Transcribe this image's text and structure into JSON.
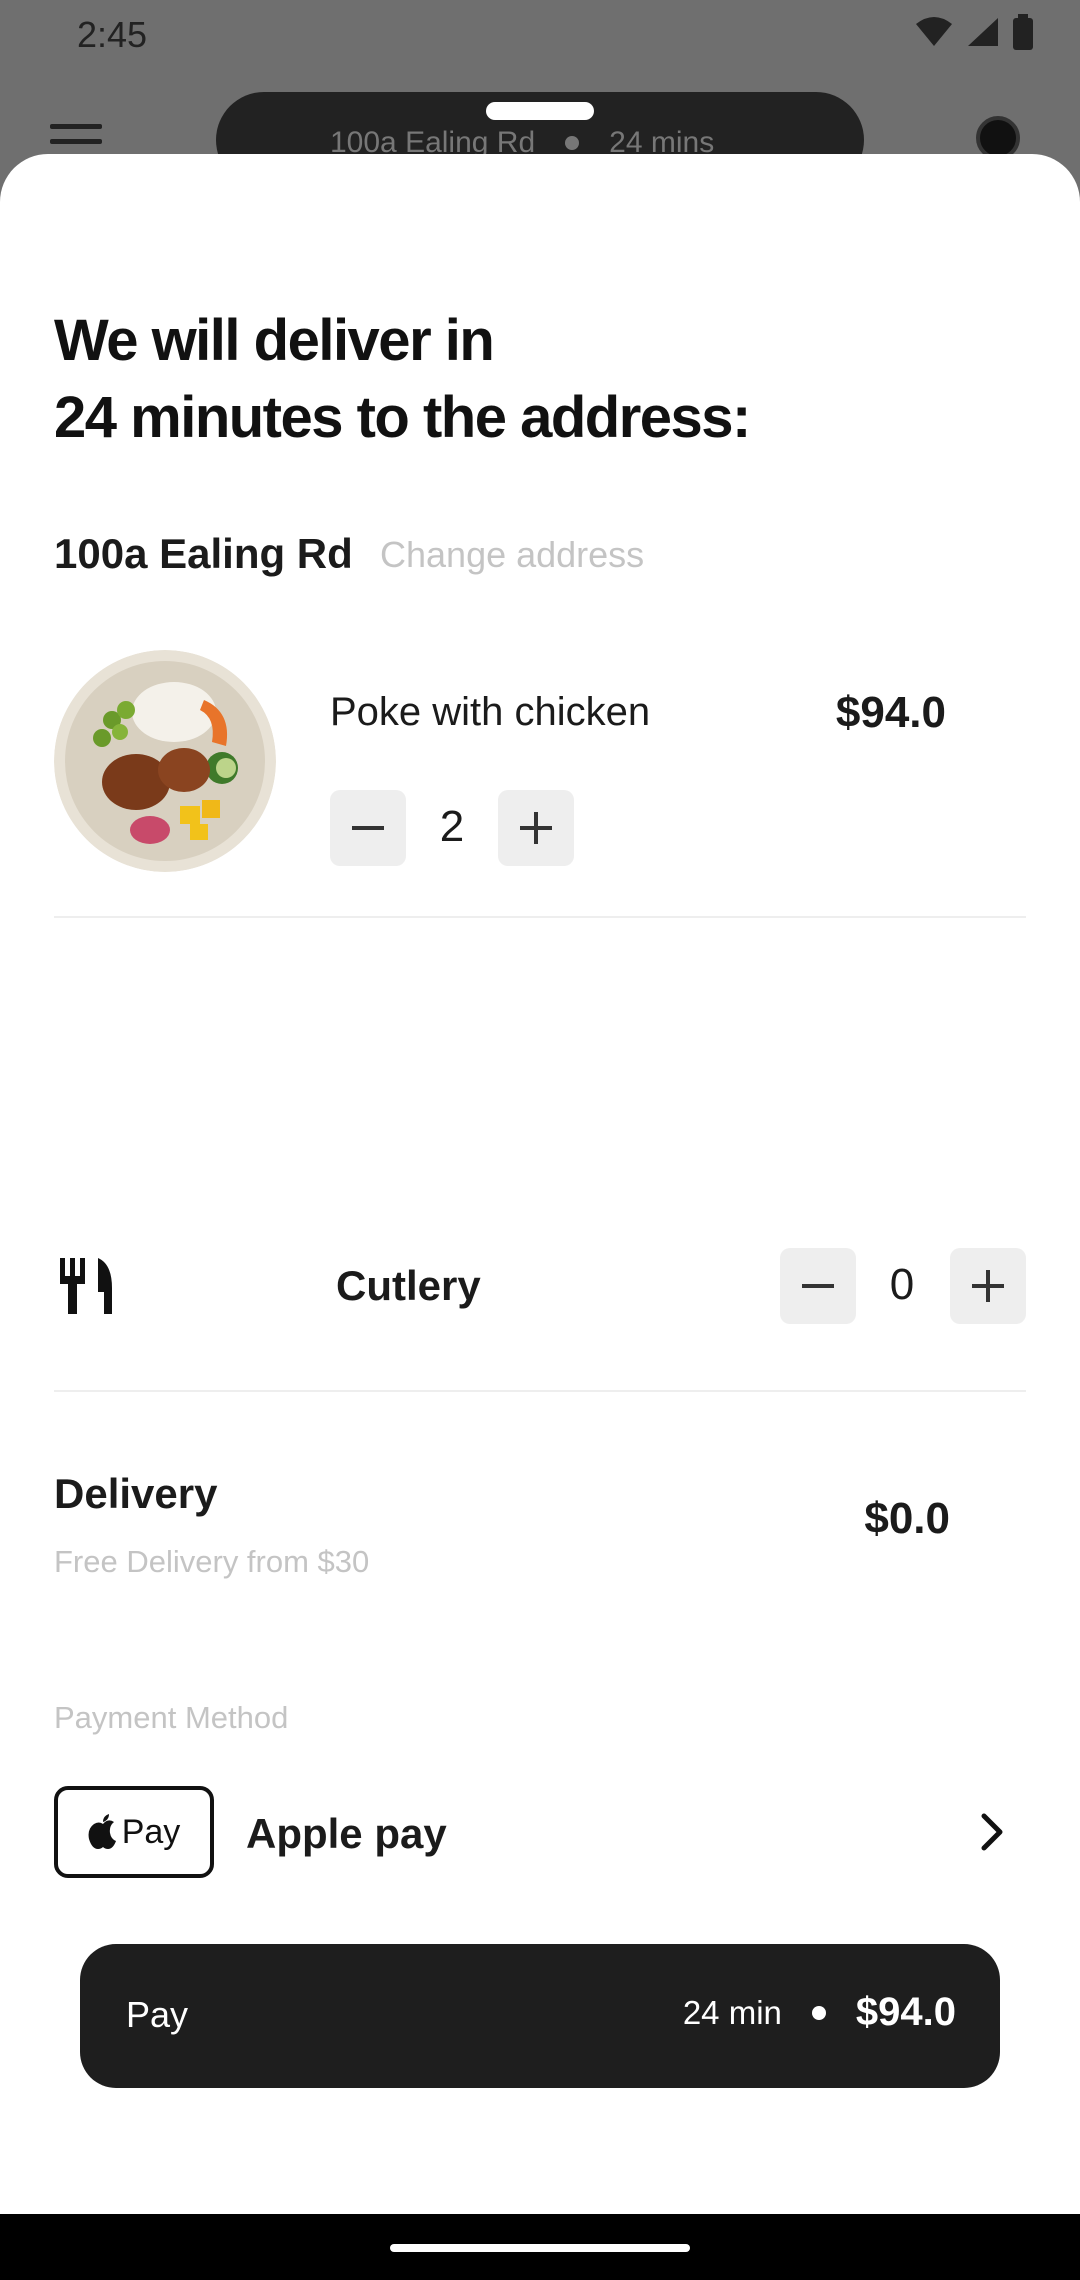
{
  "status_bar": {
    "time": "2:45"
  },
  "background": {
    "address": "100a Ealing Rd",
    "eta": "24 mins"
  },
  "sheet": {
    "headline_line1": "We will deliver in",
    "headline_line2": "24 minutes to the address:",
    "address": "100a Ealing Rd",
    "change_address": "Change address"
  },
  "cart": {
    "items": [
      {
        "name": "Poke with chicken",
        "price": "$94.0",
        "quantity": "2"
      }
    ]
  },
  "cutlery": {
    "label": "Cutlery",
    "quantity": "0"
  },
  "delivery": {
    "title": "Delivery",
    "subtitle": "Free Delivery from $30",
    "price": "$0.0"
  },
  "payment": {
    "section_label": "Payment Method",
    "badge_text": "Pay",
    "method_name": "Apple pay"
  },
  "pay_button": {
    "label": "Pay",
    "eta": "24 min",
    "total": "$94.0"
  }
}
